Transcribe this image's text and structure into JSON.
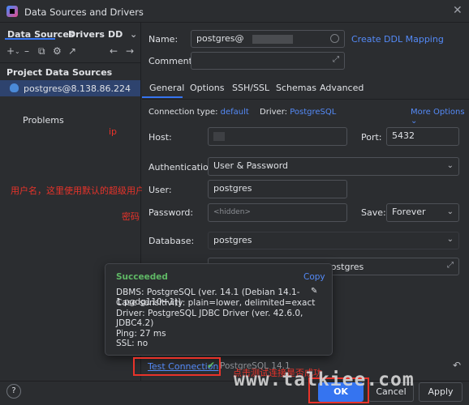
{
  "window": {
    "title": "Data Sources and Drivers"
  },
  "left": {
    "tabs": [
      "Data Sources",
      "Drivers",
      "DD"
    ],
    "section_title": "Project Data Sources",
    "datasource": "postgres@8.138.86.224",
    "problems": "Problems"
  },
  "form": {
    "name_label": "Name:",
    "name_value": "postgres@",
    "create_ddl": "Create DDL Mapping",
    "comment_label": "Comment:",
    "tabs": [
      "General",
      "Options",
      "SSH/SSL",
      "Schemas",
      "Advanced"
    ],
    "conn_type_label": "Connection type:",
    "conn_type_value": "default",
    "driver_label": "Driver:",
    "driver_value": "PostgreSQL",
    "more_options": "More Options",
    "host_label": "Host:",
    "port_label": "Port:",
    "port_value": "5432",
    "auth_label": "Authentication:",
    "auth_value": "User & Password",
    "user_label": "User:",
    "user_value": "postgres",
    "password_label": "Password:",
    "password_placeholder": "<hidden>",
    "save_label": "Save:",
    "save_value": "Forever",
    "database_label": "Database:",
    "database_value": "postgres",
    "url_suffix": "/postgres"
  },
  "popup": {
    "status": "Succeeded",
    "copy": "Copy",
    "dbms": "DBMS: PostgreSQL (ver. 14.1 (Debian 14.1-1.pgdg110+1))",
    "case": "Case sensitivity: plain=lower, delimited=exact",
    "driver": "Driver: PostgreSQL JDBC Driver (ver. 42.6.0, JDBC4.2)",
    "ping": "Ping: 27 ms",
    "ssl": "SSL: no"
  },
  "footer": {
    "test_connection": "Test Connection",
    "version": "PostgreSQL 14.1",
    "ok": "OK",
    "cancel": "Cancel",
    "apply": "Apply",
    "help": "?"
  },
  "annotations": {
    "ip": "ip",
    "user_note": "用户名，这里使用默认的超级用户",
    "password_note": "密码",
    "test_note": "点击测试连接是否成功",
    "watermark": "www.talkiee.com"
  },
  "colors": {
    "accent": "#3574f0",
    "link": "#548af7",
    "success": "#5fb865",
    "annotation": "#e8332a"
  }
}
